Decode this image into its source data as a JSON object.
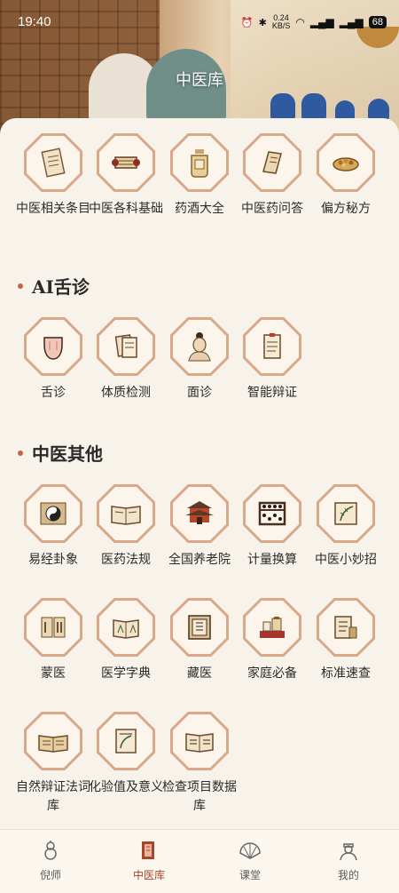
{
  "status_bar": {
    "time": "19:40",
    "network_speed": "0.24",
    "network_unit": "KB/S",
    "battery": "68"
  },
  "header": {
    "title": "中医库"
  },
  "grid_top": [
    {
      "label": "中医相关条目",
      "icon": "document-scroll-icon"
    },
    {
      "label": "中医各科基础",
      "icon": "scroll-icon"
    },
    {
      "label": "药酒大全",
      "icon": "wine-jar-icon"
    },
    {
      "label": "中医药问答",
      "icon": "book-icon"
    },
    {
      "label": "偏方秘方",
      "icon": "herb-bowl-icon"
    }
  ],
  "section_ai": {
    "title": "AI舌诊",
    "items": [
      {
        "label": "舌诊",
        "icon": "tongue-icon"
      },
      {
        "label": "体质检测",
        "icon": "document-icon"
      },
      {
        "label": "面诊",
        "icon": "face-icon"
      },
      {
        "label": "智能辩证",
        "icon": "report-icon"
      }
    ]
  },
  "section_other": {
    "title": "中医其他",
    "items": [
      {
        "label": "易经卦象",
        "icon": "yin-yang-icon"
      },
      {
        "label": "医药法规",
        "icon": "open-book-icon"
      },
      {
        "label": "全国养老院",
        "icon": "building-icon"
      },
      {
        "label": "计量换算",
        "icon": "abacus-icon"
      },
      {
        "label": "中医小妙招",
        "icon": "herb-book-icon"
      },
      {
        "label": "蒙医",
        "icon": "mongol-book-icon"
      },
      {
        "label": "医学字典",
        "icon": "dictionary-icon"
      },
      {
        "label": "藏医",
        "icon": "tibetan-book-icon"
      },
      {
        "label": "家庭必备",
        "icon": "medicine-box-icon"
      },
      {
        "label": "标准速查",
        "icon": "standard-book-icon"
      },
      {
        "label": "自然辩证法词库",
        "icon": "reading-book-icon"
      },
      {
        "label": "化验值及意义",
        "icon": "lab-book-icon"
      },
      {
        "label": "检查项目数据库",
        "icon": "database-book-icon"
      }
    ]
  },
  "bottom_nav": [
    {
      "label": "倪师",
      "icon": "gourd-icon"
    },
    {
      "label": "中医库",
      "icon": "book-stack-icon",
      "active": true
    },
    {
      "label": "课堂",
      "icon": "fan-icon"
    },
    {
      "label": "我的",
      "icon": "person-icon"
    }
  ],
  "colors": {
    "accent": "#a8442e",
    "octagon_border": "#d9a888",
    "section_dot": "#c8643c",
    "background": "#f8f3ea"
  }
}
